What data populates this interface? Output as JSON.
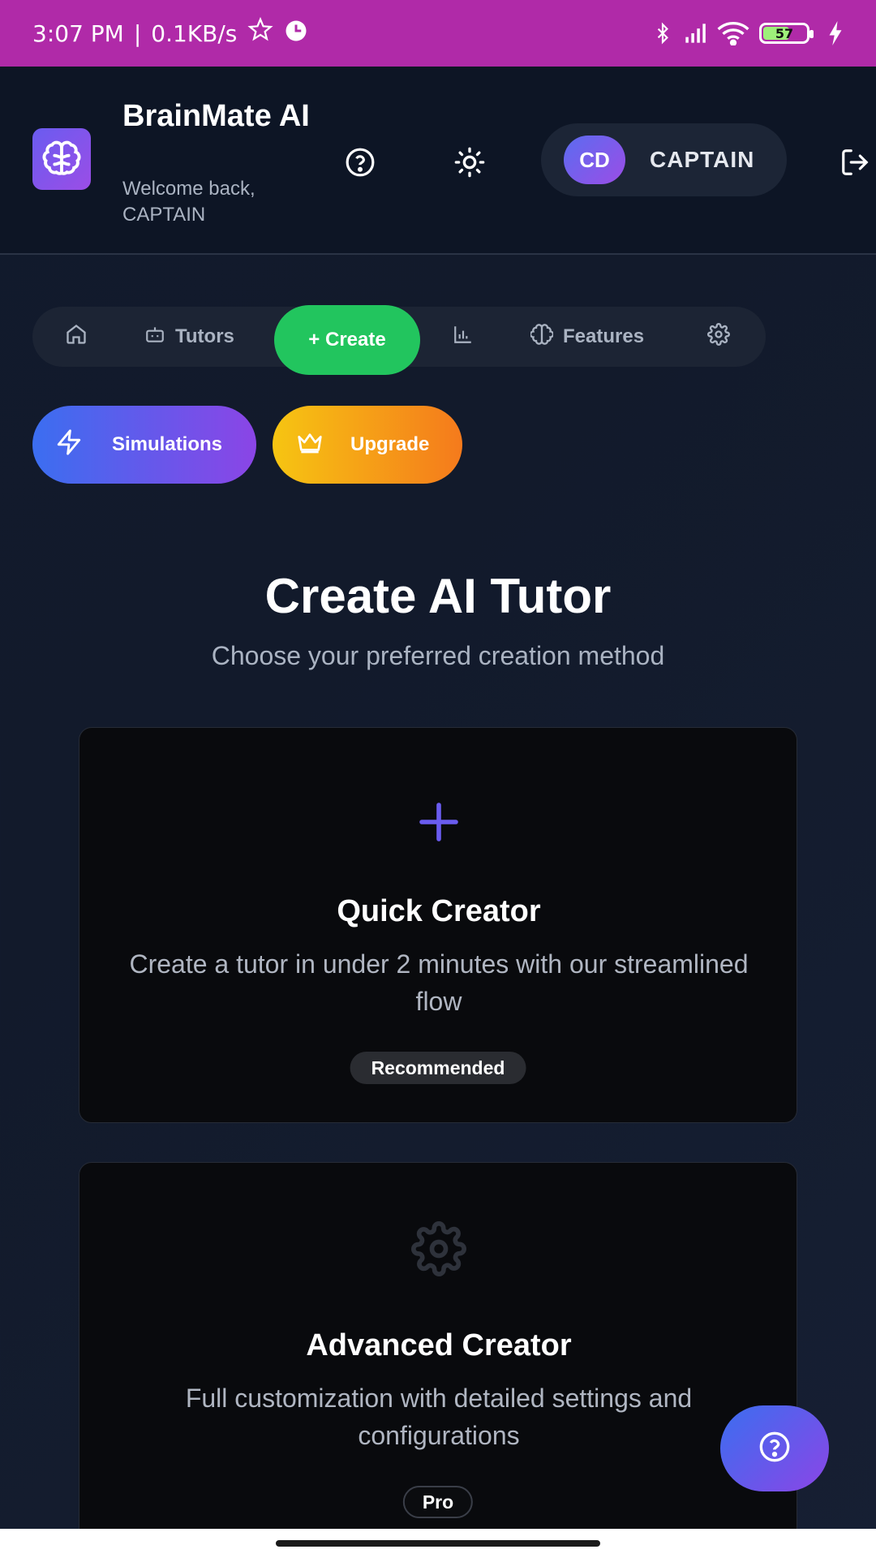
{
  "status_bar": {
    "time": "3:07 PM",
    "separator": "|",
    "network_speed": "0.1KB/s",
    "battery_level": "57"
  },
  "header": {
    "app_title": "BrainMate AI",
    "welcome": "Welcome back, CAPTAIN",
    "user": {
      "initials": "CD",
      "name": "CAPTAIN"
    }
  },
  "nav": {
    "tutors": "Tutors",
    "create": "+ Create",
    "features": "Features"
  },
  "actions": {
    "simulations": "Simulations",
    "upgrade": "Upgrade"
  },
  "main": {
    "title": "Create AI Tutor",
    "subtitle": "Choose your preferred creation method"
  },
  "cards": [
    {
      "title": "Quick Creator",
      "description": "Create a tutor in under 2 minutes with our streamlined flow",
      "badge": "Recommended"
    },
    {
      "title": "Advanced Creator",
      "description": "Full customization with detailed settings and configurations",
      "badge": "Pro"
    }
  ],
  "colors": {
    "status_bar": "#b02aa8",
    "create_green": "#22c55e",
    "accent_purple": "#6a5cf0"
  }
}
